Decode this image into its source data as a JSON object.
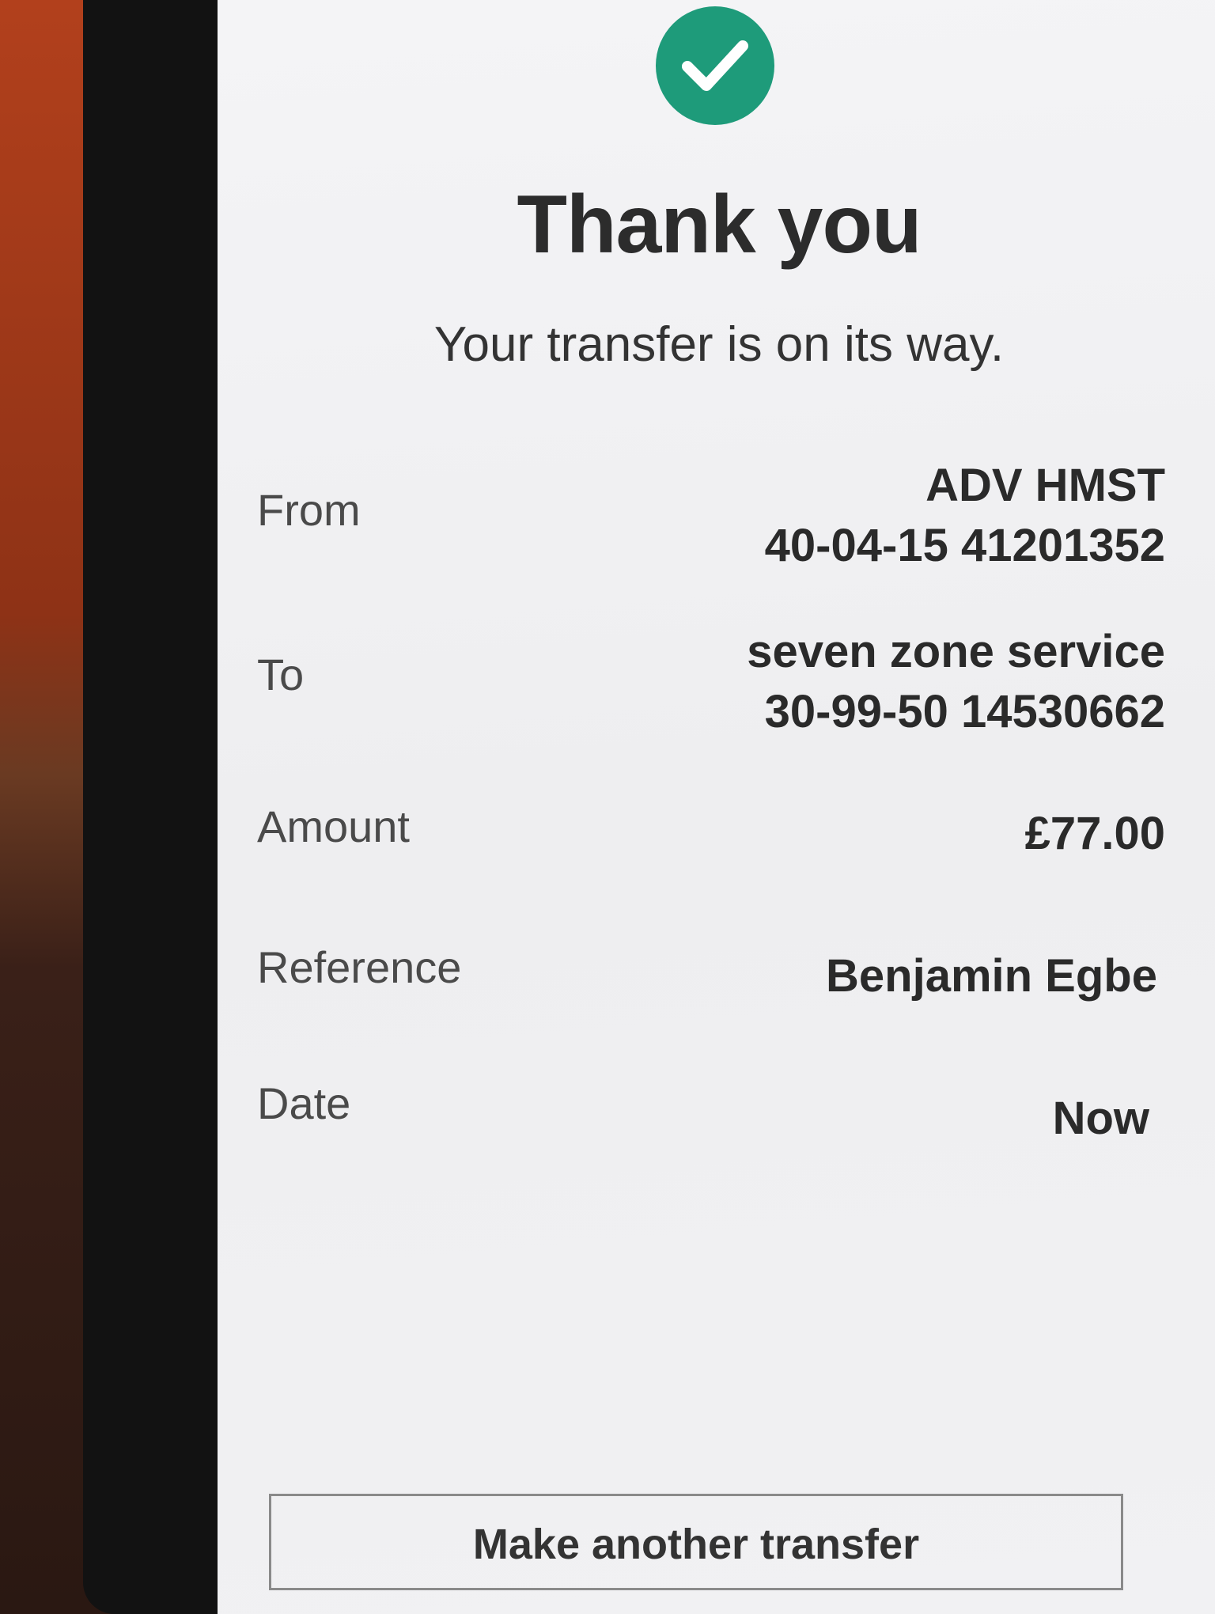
{
  "header": {
    "title": "Thank you",
    "subtitle": "Your transfer is on its way."
  },
  "details": {
    "from": {
      "label": "From",
      "name": "ADV HMST",
      "account": "40-04-15 41201352"
    },
    "to": {
      "label": "To",
      "name": "seven zone service",
      "account": "30-99-50 14530662"
    },
    "amount": {
      "label": "Amount",
      "value": "£77.00"
    },
    "reference": {
      "label": "Reference",
      "value": "Benjamin Egbe"
    },
    "date": {
      "label": "Date",
      "value": "Now"
    }
  },
  "actions": {
    "make_another_label": "Make another transfer"
  },
  "colors": {
    "success": "#1e9b7a"
  },
  "icons": {
    "success": "check-circle-icon"
  }
}
